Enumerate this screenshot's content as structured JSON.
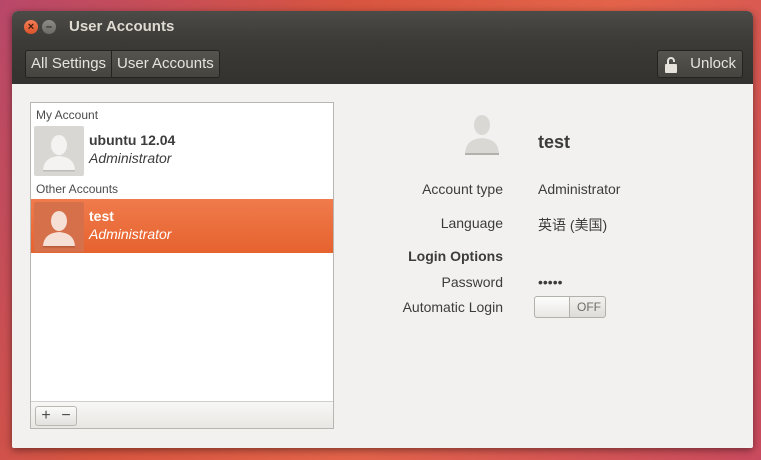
{
  "window": {
    "title": "User Accounts",
    "close_glyph": "×",
    "minimize_glyph": "–"
  },
  "toolbar": {
    "breadcrumbs": [
      "All Settings",
      "User Accounts"
    ],
    "unlock_label": "Unlock",
    "unlock_icon": "unlocked-padlock-icon"
  },
  "accounts": {
    "my_account_label": "My Account",
    "other_accounts_label": "Other Accounts",
    "my": {
      "name": "ubuntu 12.04",
      "role": "Administrator"
    },
    "others": [
      {
        "name": "test",
        "role": "Administrator",
        "selected": true
      }
    ],
    "add_label": "+",
    "remove_label": "−"
  },
  "details": {
    "name": "test",
    "account_type_label": "Account type",
    "account_type_value": "Administrator",
    "language_label": "Language",
    "language_value": "英语 (美国)",
    "login_options_label": "Login Options",
    "password_label": "Password",
    "password_value": "•••••",
    "automatic_login_label": "Automatic Login",
    "automatic_login_state": "OFF"
  },
  "colors": {
    "accent": "#e9672f",
    "titlebar": "#3c3b37",
    "window_bg": "#f2f1f0"
  }
}
